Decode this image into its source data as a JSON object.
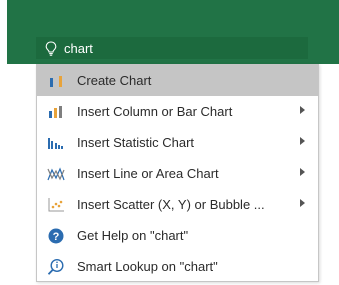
{
  "search": {
    "value": "chart",
    "icon": "lightbulb-icon"
  },
  "colors": {
    "ribbon": "#217346",
    "search_box": "#1c6a3e",
    "selected_item": "#c5c5c5",
    "help_icon": "#2b6cb0"
  },
  "menu": {
    "items": [
      {
        "label": "Create Chart",
        "icon": "create-chart-icon",
        "submenu": false,
        "selected": true
      },
      {
        "label": "Insert Column or Bar Chart",
        "icon": "column-chart-icon",
        "submenu": true,
        "selected": false
      },
      {
        "label": "Insert Statistic Chart",
        "icon": "statistic-chart-icon",
        "submenu": true,
        "selected": false
      },
      {
        "label": "Insert Line or Area Chart",
        "icon": "line-chart-icon",
        "submenu": true,
        "selected": false
      },
      {
        "label": "Insert Scatter (X, Y) or Bubble ...",
        "icon": "scatter-chart-icon",
        "submenu": true,
        "selected": false
      },
      {
        "label": "Get Help on \"chart\"",
        "icon": "help-icon",
        "submenu": false,
        "selected": false
      },
      {
        "label": "Smart Lookup on \"chart\"",
        "icon": "smart-lookup-icon",
        "submenu": false,
        "selected": false
      }
    ]
  }
}
